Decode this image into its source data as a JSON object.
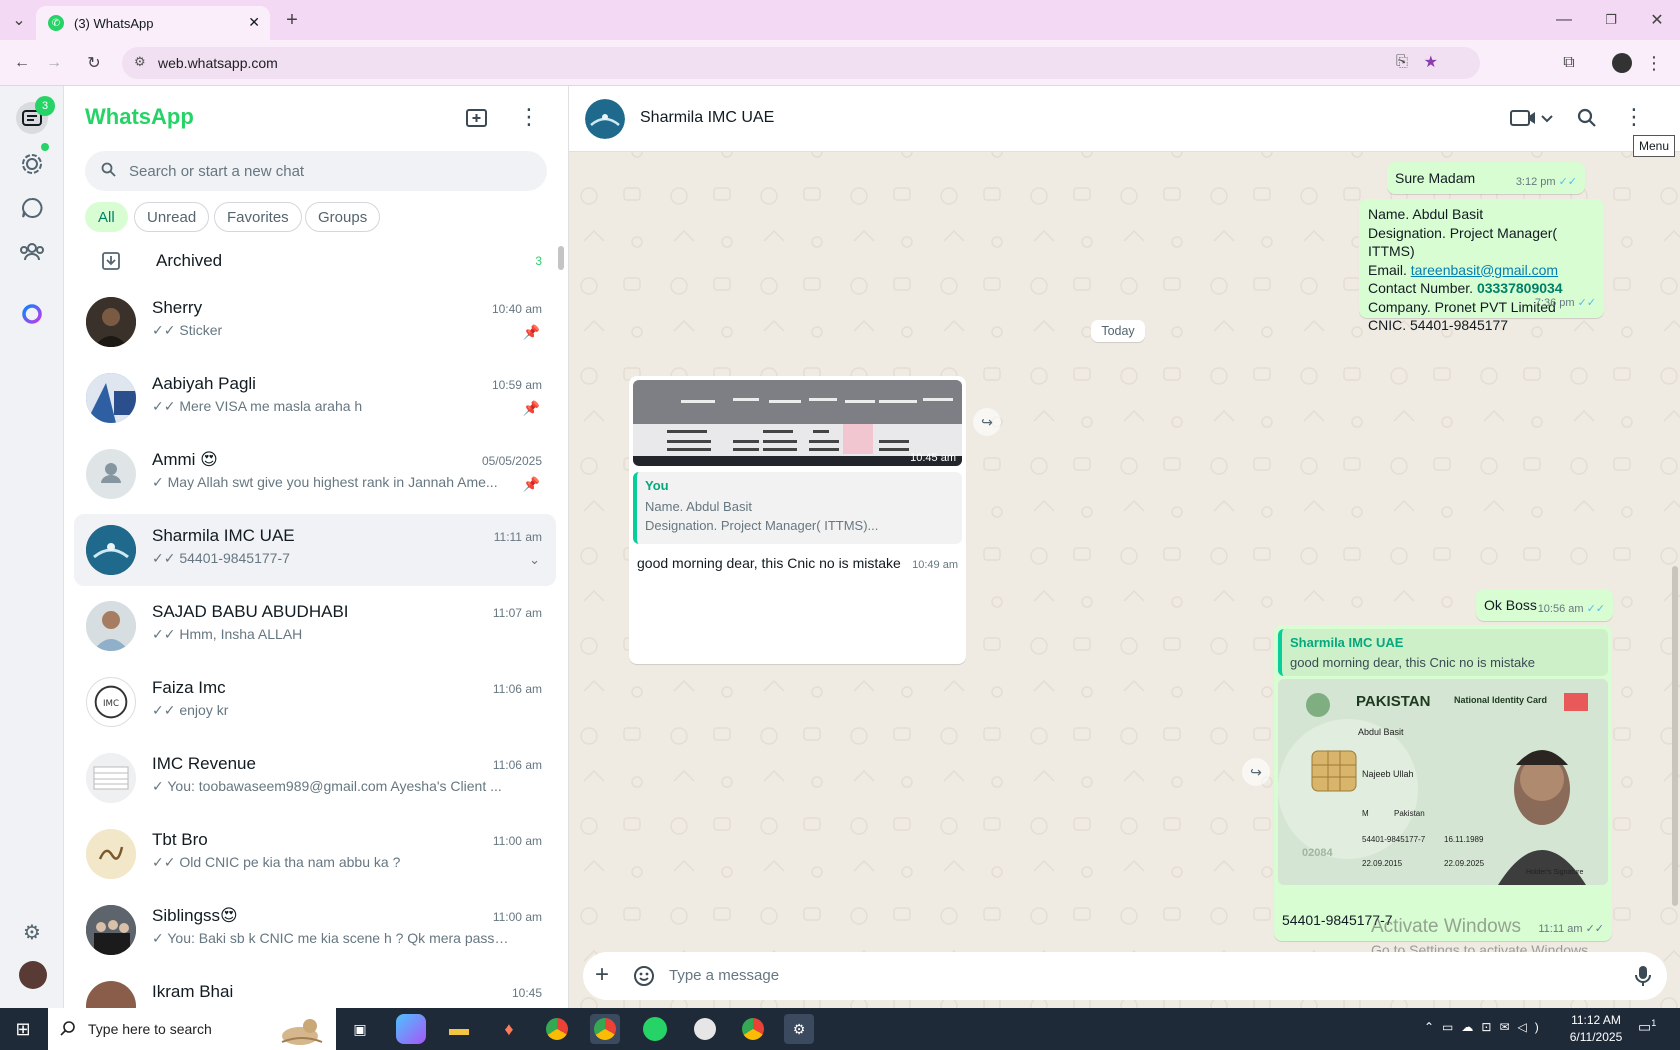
{
  "browser": {
    "tab_title": "(3) WhatsApp",
    "url": "web.whatsapp.com"
  },
  "rail": {
    "chats_badge": "3"
  },
  "sidebar": {
    "brand": "WhatsApp",
    "search_placeholder": "Search or start a new chat",
    "filters": [
      "All",
      "Unread",
      "Favorites",
      "Groups"
    ],
    "archived_label": "Archived",
    "archived_count": "3",
    "chats": [
      {
        "name": "Sherry",
        "preview": "✓✓ Sticker",
        "time": "10:40 am",
        "pinned": true
      },
      {
        "name": "Aabiyah Pagli",
        "preview": "✓✓ Mere VISA me masla araha h",
        "time": "10:59 am",
        "pinned": true
      },
      {
        "name": "Ammi 😍",
        "preview": "✓ May Allah swt give you highest rank in Jannah  Ame...",
        "time": "05/05/2025",
        "pinned": true
      },
      {
        "name": "Sharmila IMC UAE",
        "preview": "✓✓ 54401-9845177-7",
        "time": "11:11 am",
        "pinned": false
      },
      {
        "name": "SAJAD BABU ABUDHABI",
        "preview": "✓✓ Hmm, Insha ALLAH",
        "time": "11:07 am",
        "pinned": false
      },
      {
        "name": "Faiza Imc",
        "preview": "✓✓ enjoy kr",
        "time": "11:06 am",
        "pinned": false
      },
      {
        "name": "IMC Revenue",
        "preview": "✓ You: toobawaseem989@gmail.com Ayesha's Client ...",
        "time": "11:06 am",
        "pinned": false
      },
      {
        "name": "Tbt Bro",
        "preview": "✓✓ Old CNIC pe kia tha nam abbu ka ?",
        "time": "11:00 am",
        "pinned": false
      },
      {
        "name": "Siblingss😍",
        "preview": "✓ You: Baki sb k CNIC me kia scene h ? Qk mera passport ...",
        "time": "11:00 am",
        "pinned": false
      },
      {
        "name": "Ikram Bhai",
        "preview": "",
        "time": "10:45",
        "pinned": false
      }
    ]
  },
  "conversation": {
    "contact": "Sharmila IMC UAE",
    "tooltip": "Menu",
    "messages": {
      "m1_text": "Sure Madam",
      "m1_time": "3:12 pm",
      "m2_line1": "Name. Abdul Basit",
      "m2_line2": "Designation. Project Manager( ITTMS)",
      "m2_line3_label": "Email. ",
      "m2_line3_link": "tareenbasit@gmail.com",
      "m2_line4_label": "Contact Number. ",
      "m2_line4_phone": "03337809034",
      "m2_line5": "Company. Pronet PVT Limited",
      "m2_line6": "CNIC. 54401-9845177",
      "m2_time": "7:36 pm",
      "date_divider": "Today",
      "img1_time": "10:45 am",
      "quote1_author": "You",
      "quote1_line1": "Name. Abdul Basit",
      "quote1_line2": "Designation. Project Manager( ITTMS)...",
      "m3_text": "good morning dear, this Cnic no is mistake",
      "m3_time": "10:49 am",
      "m4_text": "Ok Boss",
      "m4_time": "10:56 am",
      "quote2_author": "Sharmila IMC UAE",
      "quote2_text": "good morning dear, this Cnic no is mistake",
      "card_country": "PAKISTAN",
      "card_title": "National Identity Card",
      "card_name": "Abdul Basit",
      "card_father": "Najeeb Ullah",
      "card_gender": "M",
      "card_stay": "Pakistan",
      "card_id": "54401-9845177-7",
      "card_dob": "16.11.1989",
      "card_issue": "22.09.2015",
      "card_expiry": "22.09.2025",
      "card_sig": "Holder's Signature",
      "card_serial": "02084",
      "m5_text": "54401-9845177-7",
      "m5_time": "11:11 am"
    },
    "composer_placeholder": "Type a message",
    "watermark_title": "Activate Windows",
    "watermark_sub": "Go to Settings to activate Windows."
  },
  "taskbar": {
    "search_placeholder": "Type here to search",
    "time": "11:12 AM",
    "date": "6/11/2025",
    "notif_count": "1"
  },
  "colors": {
    "accent": "#25d366",
    "outgoing_bubble": "#d9fdd3",
    "chat_bg": "#efeae2",
    "read_ticks": "#53bdeb"
  }
}
